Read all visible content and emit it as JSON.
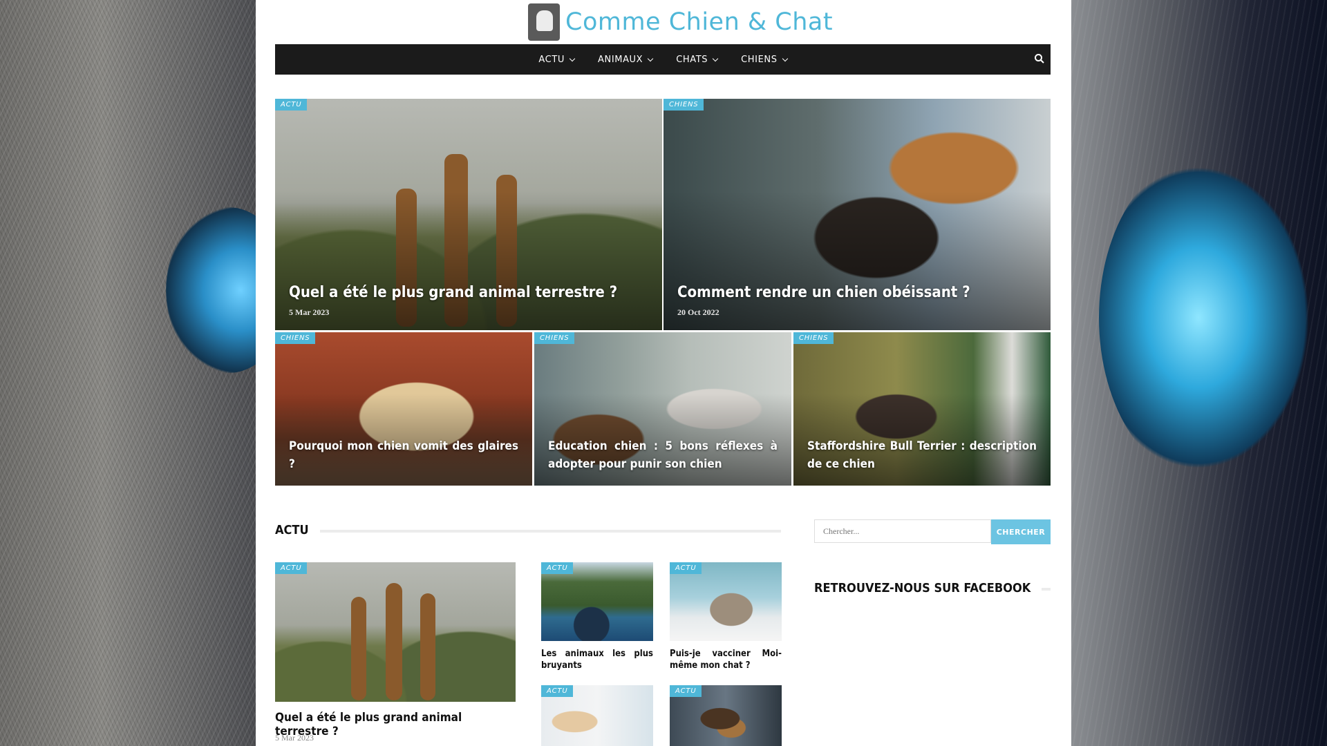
{
  "site": {
    "logo_text": "Comme Chien & Chat"
  },
  "nav": {
    "items": [
      {
        "label": "ACTU"
      },
      {
        "label": "ANIMAUX"
      },
      {
        "label": "CHATS"
      },
      {
        "label": "CHIENS"
      }
    ],
    "search_icon": "search-icon"
  },
  "featured": {
    "big": [
      {
        "category": "ACTU",
        "title": "Quel a été le plus grand animal terrestre ?",
        "date": "5 Mar 2023"
      },
      {
        "category": "CHIENS",
        "title": "Comment rendre un chien obéissant ?",
        "date": "20 Oct 2022"
      }
    ],
    "small": [
      {
        "category": "CHIENS",
        "title": "Pourquoi mon chien vomit des glaires ?"
      },
      {
        "category": "CHIENS",
        "title": "Education chien : 5 bons réflexes à adopter pour punir son chien"
      },
      {
        "category": "CHIENS",
        "title": "Staffordshire Bull Terrier : description de ce chien"
      }
    ]
  },
  "actu_section": {
    "heading": "ACTU",
    "main_post": {
      "category": "ACTU",
      "title": "Quel a été le plus grand animal terrestre ?",
      "date": "5 Mar 2023"
    },
    "posts": [
      {
        "category": "ACTU",
        "title": "Les animaux les plus bruyants"
      },
      {
        "category": "ACTU",
        "title": "Puis-je vacciner Moi-même mon chat ?"
      },
      {
        "category": "ACTU",
        "title": ""
      },
      {
        "category": "ACTU",
        "title": ""
      }
    ]
  },
  "sidebar": {
    "search_placeholder": "Chercher...",
    "search_button": "CHERCHER",
    "facebook_heading": "RETROUVEZ-NOUS SUR FACEBOOK"
  },
  "colors": {
    "accent": "#4fb7d8",
    "nav_bg": "#1b1b1b",
    "search_button_bg": "#6cc4e2"
  }
}
